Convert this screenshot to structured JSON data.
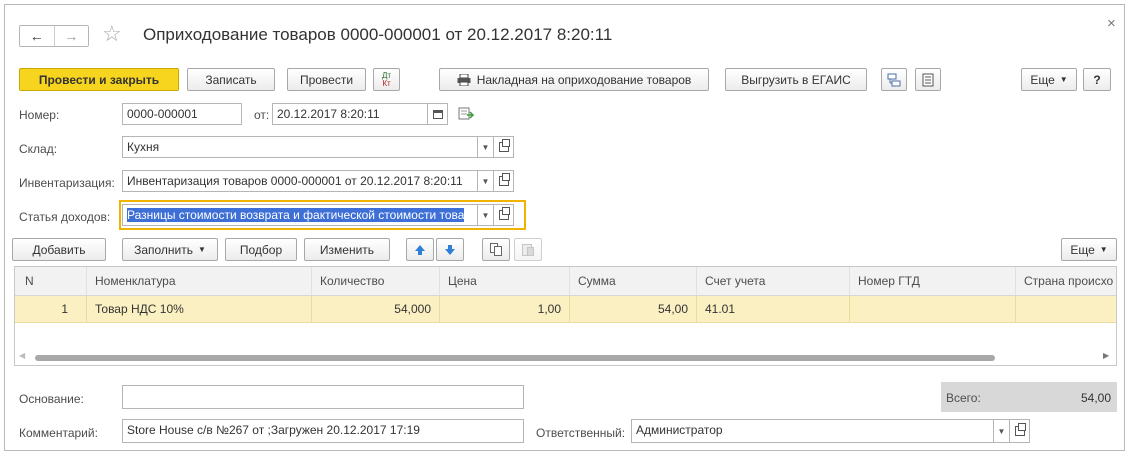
{
  "window": {
    "title": "Оприходование товаров 0000-000001 от 20.12.2017 8:20:11",
    "close_glyph": "×",
    "back_glyph": "←",
    "forward_glyph": "→",
    "star_glyph": "☆"
  },
  "toolbar": {
    "post_close": "Провести и закрыть",
    "save": "Записать",
    "post": "Провести",
    "dtkt_top": "Дт",
    "dtkt_bottom": "Кт",
    "invoice": "Накладная на оприходование товаров",
    "export": "Выгрузить в ЕГАИС",
    "more": "Еще",
    "help": "?"
  },
  "form": {
    "number_label": "Номер:",
    "number_value": "0000-000001",
    "date_label": "от:",
    "date_value": "20.12.2017  8:20:11",
    "warehouse_label": "Склад:",
    "warehouse_value": "Кухня",
    "inventory_label": "Инвентаризация:",
    "inventory_value": "Инвентаризация товаров 0000-000001 от 20.12.2017 8:20:11",
    "income_label": "Статья доходов:",
    "income_value": "Разницы стоимости возврата и фактической стоимости това"
  },
  "table_toolbar": {
    "add": "Добавить",
    "fill": "Заполнить",
    "pick": "Подбор",
    "change": "Изменить",
    "more": "Еще"
  },
  "table": {
    "columns": [
      "N",
      "Номенклатура",
      "Количество",
      "Цена",
      "Сумма",
      "Счет учета",
      "Номер ГТД",
      "Страна происхо"
    ],
    "rows": [
      [
        "1",
        "Товар НДС 10%",
        "54,000",
        "1,00",
        "54,00",
        "41.01",
        "",
        ""
      ]
    ]
  },
  "footer": {
    "basis_label": "Основание:",
    "basis_value": "",
    "total_label": "Всего:",
    "total_value": "54,00",
    "comment_label": "Комментарий:",
    "comment_value": "Store House с/в №267 от ;Загружен 20.12.2017 17:19",
    "responsible_label": "Ответственный:",
    "responsible_value": "Администратор"
  },
  "colors": {
    "accent_yellow": "#f7d51e",
    "row_highlight": "#fbf0c2",
    "selection_blue": "#3d6fd6",
    "focus_border": "#f0b400",
    "total_bg": "#d8d8d8"
  }
}
